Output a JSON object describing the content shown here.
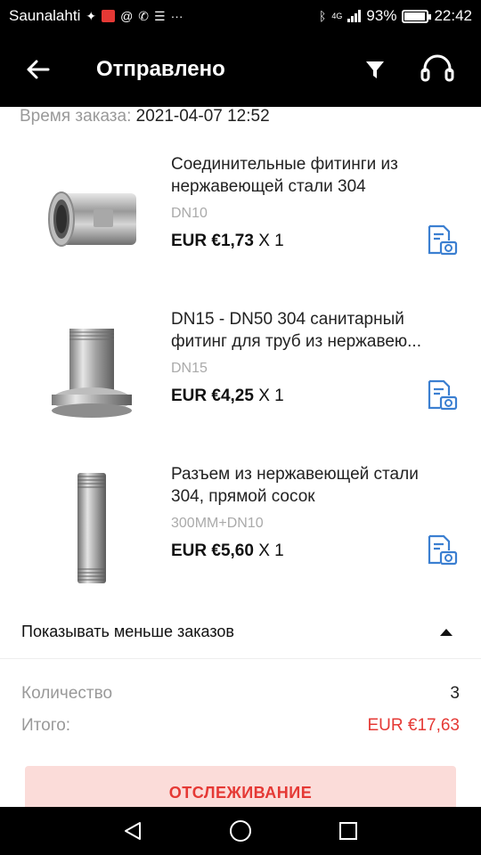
{
  "status_bar": {
    "carrier": "Saunalahti",
    "battery_percent": "93%",
    "battery_level": 0.93,
    "time": "22:42",
    "network": "4G",
    "icons": [
      "fox-icon",
      "red-app-icon",
      "at-icon",
      "missed-call-icon",
      "message-icon",
      "more-icon",
      "bluetooth-icon",
      "signal-icon",
      "battery-icon"
    ]
  },
  "app_bar": {
    "title": "Отправлено",
    "icons": [
      "back-arrow-icon",
      "filter-icon",
      "headset-support-icon"
    ]
  },
  "order": {
    "time_label": "Время заказа:",
    "time_value": "2021-04-07 12:52"
  },
  "products": [
    {
      "title": "Соединительные фитинги из нержавеющей стали 304",
      "variant": "DN10",
      "price": "EUR €1,73",
      "qty": "X 1",
      "image": "threaded-coupling-fitting"
    },
    {
      "title": "DN15 - DN50 304 санитарный фитинг для труб из нержавею...",
      "variant": "DN15",
      "price": "EUR €4,25",
      "qty": "X 1",
      "image": "sanitary-ferrule-fitting"
    },
    {
      "title": "Разъем из нержавеющей стали 304, прямой сосок",
      "variant": "300MM+DN10",
      "price": "EUR €5,60",
      "qty": "X 1",
      "image": "straight-pipe-nipple"
    }
  ],
  "show_less_label": "Показывать меньше заказов",
  "summary": {
    "quantity_label": "Количество",
    "quantity_value": "3",
    "total_label": "Итого:",
    "total_value": "EUR €17,63"
  },
  "track_button_label": "ОТСЛЕЖИВАНИЕ",
  "colors": {
    "accent_red": "#e53935",
    "track_button_bg": "#fbdcd9",
    "receipt_icon_blue": "#3b7fd1",
    "bars": "#000000"
  }
}
